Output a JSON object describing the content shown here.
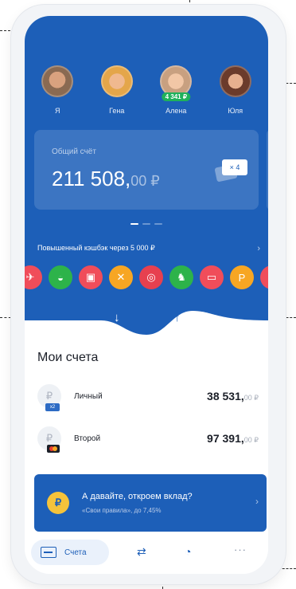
{
  "colors": {
    "brand_blue": "#1d5fb8",
    "badge_green": "#1fb15b",
    "coin_yellow": "#f5c33b"
  },
  "contacts": [
    {
      "name": "Я",
      "skin": "#d9a27f",
      "bg": "#8a6a52"
    },
    {
      "name": "Гена",
      "skin": "#f0b98f",
      "bg": "#e4a64a"
    },
    {
      "name": "Алена",
      "skin": "#f2c7a6",
      "bg": "#c8a080",
      "badge": "4 341 ₽"
    },
    {
      "name": "Юля",
      "skin": "#e7b08f",
      "bg": "#6b3b2b"
    }
  ],
  "total_account": {
    "label": "Общий счёт",
    "amount_main": "211 508,",
    "amount_cents": "00 ₽",
    "cards_count": "× 4"
  },
  "cashback_banner": {
    "text": "Повышенный кэшбэк через 5 000 ₽"
  },
  "categories": [
    {
      "icon": "plane-icon",
      "glyph": "✈",
      "color": "#f04d5a"
    },
    {
      "icon": "burger-icon",
      "glyph": "◒",
      "color": "#2db34a"
    },
    {
      "icon": "train-icon",
      "glyph": "▣",
      "color": "#f04d5a"
    },
    {
      "icon": "restaurant-icon",
      "glyph": "✕",
      "color": "#f7a623"
    },
    {
      "icon": "lifebuoy-icon",
      "glyph": "◎",
      "color": "#e7404f"
    },
    {
      "icon": "toy-horse-icon",
      "glyph": "♞",
      "color": "#2db34a"
    },
    {
      "icon": "monitor-icon",
      "glyph": "▭",
      "color": "#f04d5a"
    },
    {
      "icon": "parking-icon",
      "glyph": "P",
      "color": "#f7a623"
    },
    {
      "icon": "book-icon",
      "glyph": "▤",
      "color": "#f04d5a"
    }
  ],
  "accounts_section": {
    "title": "Мои счета",
    "items": [
      {
        "name": "Личный",
        "amount_main": "38 531,",
        "amount_cents": "00 ₽",
        "card_tag": "x2"
      },
      {
        "name": "Второй",
        "amount_main": "97 391,",
        "amount_cents": "00 ₽"
      }
    ]
  },
  "promo": {
    "title": "А давайте, откроем вклад?",
    "subtitle": "«Свои правила», до 7,45%",
    "coin_glyph": "₽"
  },
  "tabbar": {
    "accounts_label": "Счета"
  }
}
